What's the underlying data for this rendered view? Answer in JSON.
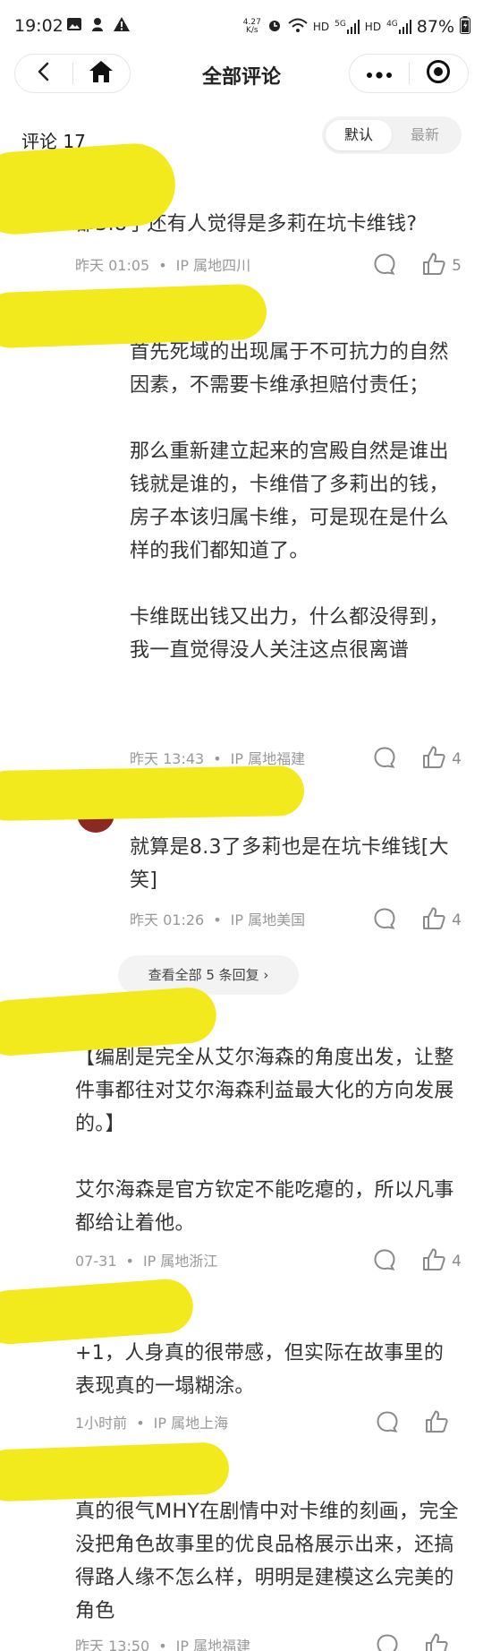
{
  "status": {
    "time": "19:02",
    "speed_top": "4.27",
    "speed_bottom": "K/s",
    "net1": "HD",
    "net2": "5G",
    "net3": "HD",
    "net4": "4G",
    "battery": "87%"
  },
  "nav": {
    "title": "全部评论"
  },
  "header": {
    "count_label": "评论 17",
    "sort_default": "默认",
    "sort_latest": "最新"
  },
  "comments": [
    {
      "paragraphs": [
        "都3.8了还有人觉得是多莉在坑卡维钱?"
      ],
      "time": "昨天 01:05",
      "location": "IP 属地四川",
      "likes": "5"
    },
    {
      "paragraphs": [
        "首先死域的出现属于不可抗力的自然因素，不需要卡维承担赔付责任；",
        "那么重新建立起来的宫殿自然是谁出钱就是谁的，卡维借了多莉出的钱，房子本该归属卡维，可是现在是什么样的我们都知道了。",
        "卡维既出钱又出力，什么都没得到，我一直觉得没人关注这点很离谱"
      ],
      "time": "昨天 13:43",
      "location": "IP 属地福建",
      "likes": "4"
    },
    {
      "paragraphs": [
        "就算是8.3了多莉也是在坑卡维钱[大笑]"
      ],
      "time": "昨天 01:26",
      "location": "IP 属地美国",
      "likes": "4"
    },
    {
      "paragraphs": [
        "【编剧是完全从艾尔海森的角度出发，让整件事都往对艾尔海森利益最大化的方向发展的。】",
        "艾尔海森是官方钦定不能吃瘪的，所以凡事都给让着他。"
      ],
      "time": "07-31",
      "location": "IP 属地浙江",
      "likes": "4"
    },
    {
      "paragraphs": [
        "+1，人身真的很带感，但实际在故事里的表现真的一塌糊涂。"
      ],
      "time": "1小时前",
      "location": "IP 属地上海",
      "likes": ""
    },
    {
      "paragraphs": [
        "真的很气MHY在剧情中对卡维的刻画，完全没把角色故事里的优良品格展示出来，还搞得路人缘不怎么样，明明是建模这么完美的角色"
      ],
      "time": "昨天 13:50",
      "location": "IP 属地福建",
      "likes": ""
    }
  ],
  "reply_link": "查看全部 5 条回复 ›",
  "icons": {
    "back": "back-arrow-icon",
    "home": "home-icon",
    "more": "more-dots-icon",
    "close": "record-circle-icon",
    "comment": "comment-bubble-icon",
    "like": "thumbs-up-icon"
  },
  "colors": {
    "highlight_redaction": "#f2ea1d",
    "meta_gray": "#999999"
  }
}
